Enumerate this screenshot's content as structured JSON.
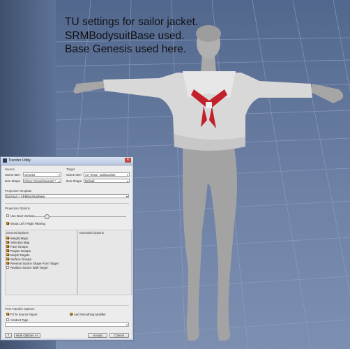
{
  "note": {
    "lines": [
      "TU settings for sailor jacket.",
      "SRMBodysuitBase used.",
      "Base Genesis used here."
    ]
  },
  "dialog": {
    "title": "Transfer Utility",
    "close_icon": "close-icon",
    "source": {
      "header": "Source",
      "scene_item_label": "Scene Item",
      "scene_item_value": "Genesis",
      "item_shape_label": "Item Shape",
      "item_shape_value": "Clone: Clone(Genesis) *"
    },
    "target": {
      "header": "Target",
      "scene_item_label": "Scene Item",
      "scene_item_value": "A3_Recte_SailorJacket",
      "item_shape_label": "Item Shape",
      "item_shape_value": "Default"
    },
    "projection_template": {
      "header": "Projection Template",
      "value": "Bodysuit > SRMBodysuitBase"
    },
    "projection_options": {
      "header": "Projection Options",
      "use_near_vertices": "Use Near Vertices",
      "smart_lr": "Smart Left / Right Filtering"
    },
    "general_options": {
      "header": "General Options",
      "items": [
        {
          "label": "Weight Maps",
          "checked": true
        },
        {
          "label": "Selection Map",
          "checked": true
        },
        {
          "label": "Face Groups",
          "checked": true
        },
        {
          "label": "Region Groups",
          "checked": true
        },
        {
          "label": "Morph Targets",
          "checked": true
        },
        {
          "label": "Surface Groups",
          "checked": true
        },
        {
          "label": "Reverse Source Shape From Target",
          "checked": true
        },
        {
          "label": "Replace Source With Target",
          "checked": false
        }
      ]
    },
    "extended_options": {
      "header": "Extended Options"
    },
    "post_transfer": {
      "header": "Post Transfer Options",
      "fit_to_source": "Fit To Source Figure",
      "add_smoothing": "Add Smoothing Modifier",
      "content_type": "Content Type"
    },
    "buttons": {
      "help": "?",
      "hide_options": "Hide Options <<",
      "accept": "Accept",
      "cancel": "Cancel"
    }
  },
  "colors": {
    "viewport_bg": "#5f7499",
    "grid_line": "#8ea0c2",
    "figure": "#a3a3a3",
    "jacket": "#d8d8d8",
    "scarf": "#c2202b",
    "checkbox_on": "#e9a23b"
  }
}
